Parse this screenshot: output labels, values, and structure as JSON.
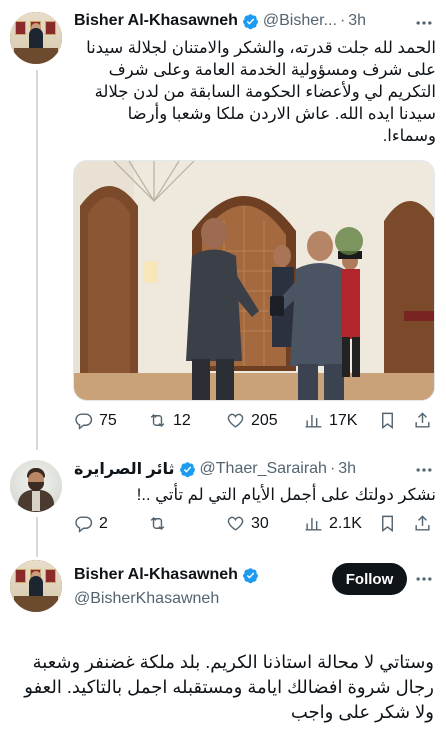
{
  "tweet1": {
    "author_name": "Bisher Al-Khasawneh",
    "handle": "@Bisher...",
    "time": "3h",
    "text": "الحمد لله جلت قدرته، والشكر والامتنان لجلالة سيدنا على شرف ومسؤولية الخدمة العامة وعلى شرف التكريم لي ولأعضاء الحكومة السابقة من لدن جلالة سيدنا ايده الله. عاش الاردن ملكا وشعبا وأرضا وسماءا.",
    "stats": {
      "replies": "75",
      "retweets": "12",
      "likes": "205",
      "views": "17K"
    }
  },
  "tweet2": {
    "author_name": "ثائر الصرايرة",
    "handle": "@Thaer_Sarairah",
    "time": "3h",
    "text": "نشكر دولتك على أجمل الأيام التي لم تأتي ..!",
    "stats": {
      "replies": "2",
      "retweets": "",
      "likes": "30",
      "views": "2.1K"
    }
  },
  "tweet3": {
    "author_name": "Bisher Al-Khasawneh",
    "handle": "@BisherKhasawneh",
    "follow_label": "Follow",
    "text": "وستاتي لا محالة استاذنا الكريم. بلد ملكة غضنفر وشعبة رجال شروة افضالك ايامة ومستقبله اجمل بالتاكيد. العفو ولا شكر على واجب"
  },
  "colors": {
    "verified": "#1d9bf0",
    "text": "#0f1419",
    "secondary": "#536471",
    "thread": "#cfd9de"
  },
  "icons": [
    "verified-badge-icon",
    "more-icon",
    "reply-icon",
    "retweet-icon",
    "like-icon",
    "views-icon",
    "bookmark-icon",
    "share-icon"
  ]
}
